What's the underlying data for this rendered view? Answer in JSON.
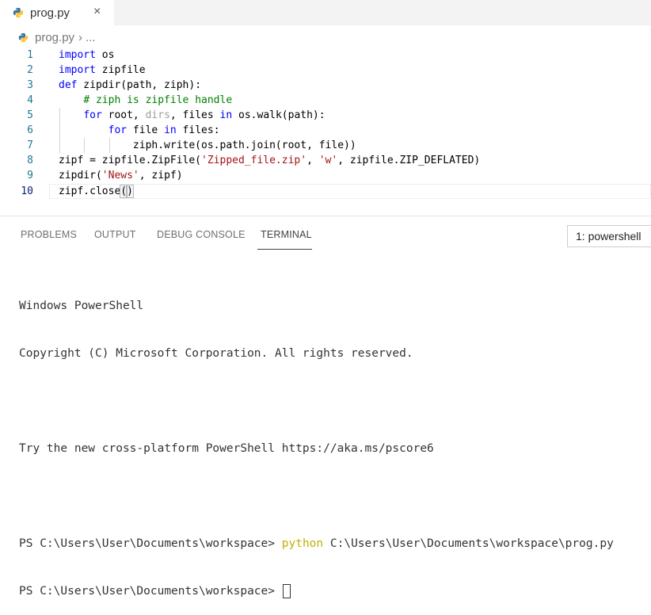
{
  "tab": {
    "file_name": "prog.py",
    "close_glyph": "×",
    "icon": "python-icon"
  },
  "breadcrumb": {
    "file": "prog.py",
    "separator": "›",
    "more": "..."
  },
  "editor": {
    "active_line": 10,
    "lines": [
      {
        "n": "1",
        "html": "<span class='kw'>import</span> os"
      },
      {
        "n": "2",
        "html": "<span class='kw'>import</span> zipfile"
      },
      {
        "n": "3",
        "html": "<span class='kw'>def</span> zipdir(path, ziph):"
      },
      {
        "n": "4",
        "html": "    <span class='cmt'># ziph is zipfile handle</span>"
      },
      {
        "n": "5",
        "html": "    <span class='kw'>for</span> root, <span class='dim'>dirs</span>, files <span class='kw'>in</span> os.walk(path):"
      },
      {
        "n": "6",
        "html": "        <span class='kw'>for</span> file <span class='kw'>in</span> files:"
      },
      {
        "n": "7",
        "html": "            ziph.write(os.path.join(root, file))"
      },
      {
        "n": "8",
        "html": "zipf = zipfile.ZipFile(<span class='str'>'Zipped_file.zip'</span>, <span class='str'>'w'</span>, zipfile.ZIP_DEFLATED)"
      },
      {
        "n": "9",
        "html": "zipdir(<span class='str'>'News'</span>, zipf)"
      },
      {
        "n": "10",
        "html": "zipf.close<span class='paren-match'>(</span><span class='paren-match'>)</span><span class='caret'></span>"
      }
    ]
  },
  "panel": {
    "tabs": [
      "PROBLEMS",
      "OUTPUT",
      "DEBUG CONSOLE",
      "TERMINAL"
    ],
    "active_tab": "TERMINAL",
    "terminal_selector": "1: powershell"
  },
  "terminal": {
    "lines": [
      "Windows PowerShell",
      "Copyright (C) Microsoft Corporation. All rights reserved.",
      "",
      "Try the new cross-platform PowerShell https://aka.ms/pscore6",
      ""
    ],
    "prompt": "PS C:\\Users\\User\\Documents\\workspace>",
    "command_name": "python",
    "command_arg": "C:\\Users\\User\\Documents\\workspace\\prog.py",
    "prompt2": "PS C:\\Users\\User\\Documents\\workspace>"
  }
}
